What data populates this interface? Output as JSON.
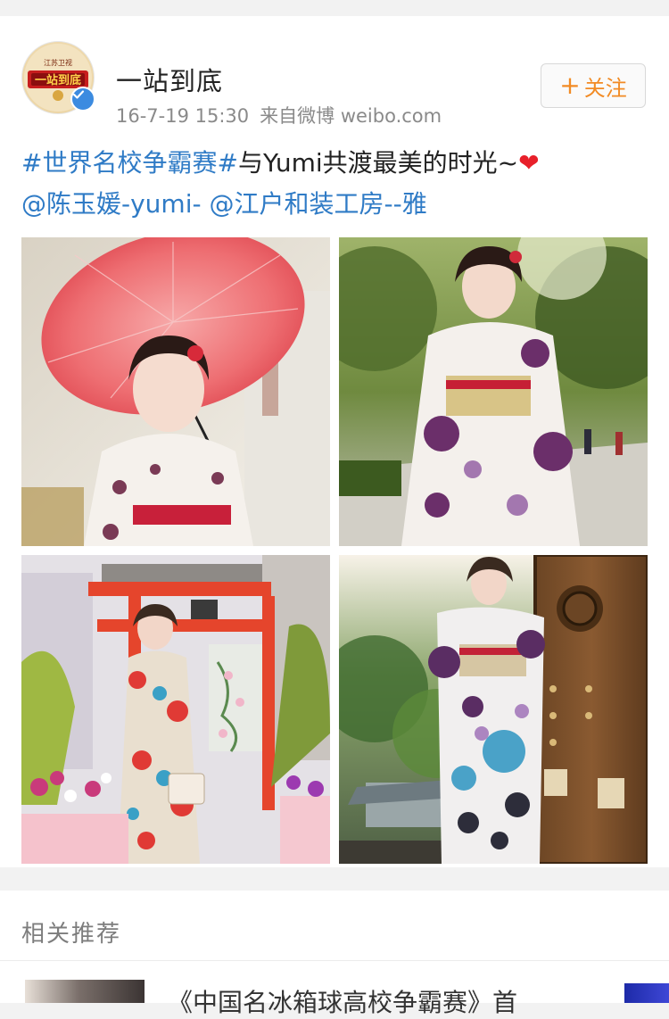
{
  "post": {
    "username": "一站到底",
    "date": "16-7-19 15:30",
    "source": "来自微博 weibo.com",
    "follow_label": "关注",
    "follow_plus": "+",
    "text": {
      "hashtag": "#世界名校争霸赛#",
      "body": "与Yumi共渡最美的时光~",
      "mention_1": "@陈玉媛-yumi-",
      "mention_2": "@江户和装工房--雅"
    },
    "photos": [
      {
        "icon": "kimono-umbrella-photo"
      },
      {
        "icon": "kimono-park-photo"
      },
      {
        "icon": "kimono-torii-photo"
      },
      {
        "icon": "kimono-door-photo"
      }
    ]
  },
  "related": {
    "title": "相关推荐",
    "item_text": "《中国名冰箱球高校争霸赛》首"
  },
  "colors": {
    "link": "#2f7bc6",
    "follow": "#f28b24",
    "heart": "#e8202a",
    "verified": "#3c8be0"
  }
}
